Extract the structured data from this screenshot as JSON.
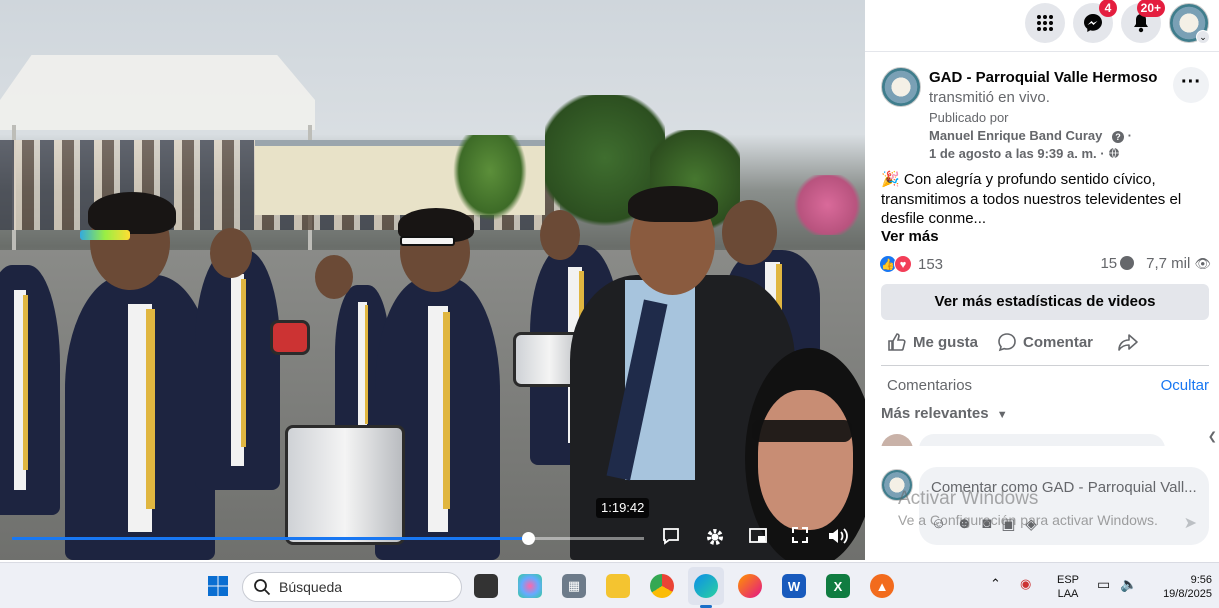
{
  "video": {
    "hover_time": "1:19:42",
    "progress_fraction": 0.817
  },
  "header": {
    "messenger_badge": "4",
    "notifications_badge": "20+"
  },
  "post": {
    "page_name": "GAD - Parroquial Valle Hermoso",
    "action": "transmitió en vivo.",
    "published_label": "Publicado por",
    "publisher": "Manuel Enrique Band Curay",
    "sep1": "·",
    "date": "1 de agosto a las 9:39 a. m.",
    "sep2": "·",
    "emoji": "🎉",
    "text": "Con alegría y profundo sentido cívico, transmitimos a todos nuestros televidentes el desfile conme...",
    "see_more": "Ver más",
    "reaction_count": "153",
    "comment_count": "15",
    "view_count": "7,7 mil",
    "stats_button": "Ver más estadísticas de videos",
    "like": "Me gusta",
    "comment": "Comentar"
  },
  "comments": {
    "label": "Comentarios",
    "hide": "Ocultar",
    "sort": "Más relevantes",
    "placeholder": "Comentar como GAD - Parroquial Vall..."
  },
  "watermark": {
    "line1": "Activar Windows",
    "line2": "Ve a Configuración para activar Windows."
  },
  "taskbar": {
    "search": "Búsqueda",
    "lang1": "ESP",
    "lang2": "LAA",
    "time": "9:56",
    "date": "19/8/2025"
  },
  "colors": {
    "accent": "#1877f2",
    "badge": "#e41e3f"
  }
}
